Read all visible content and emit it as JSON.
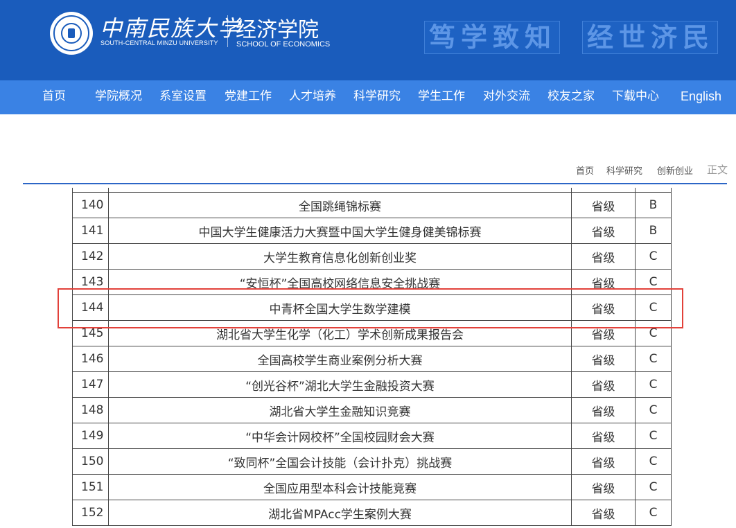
{
  "header": {
    "university_name_cn": "中南民族大学",
    "university_name_en": "SOUTH-CENTRAL MINZU UNIVERSITY",
    "school_name_cn": "经济学院",
    "school_name_en": "SCHOOL OF ECONOMICS",
    "motto_left": "笃学致知",
    "motto_right": "经世济民",
    "brand_color": "#1a5cbc"
  },
  "nav": {
    "items": [
      {
        "label": "首页"
      },
      {
        "label": "学院概况"
      },
      {
        "label": "系室设置"
      },
      {
        "label": "党建工作"
      },
      {
        "label": "人才培养"
      },
      {
        "label": "科学研究"
      },
      {
        "label": "学生工作"
      },
      {
        "label": "对外交流"
      },
      {
        "label": "校友之家"
      },
      {
        "label": "下载中心"
      },
      {
        "label": "English"
      }
    ],
    "color": "#3a82e4"
  },
  "breadcrumb": {
    "items": [
      "首页",
      "科学研究",
      "创新创业"
    ],
    "current": "正文"
  },
  "table": {
    "rows": [
      {
        "no": "140",
        "name": "全国跳绳锦标赛",
        "level": "省级",
        "grade": "B"
      },
      {
        "no": "141",
        "name": "中国大学生健康活力大赛暨中国大学生健身健美锦标赛",
        "level": "省级",
        "grade": "B"
      },
      {
        "no": "142",
        "name": "大学生教育信息化创新创业奖",
        "level": "省级",
        "grade": "C"
      },
      {
        "no": "143",
        "name": "“安恒杯”全国高校网络信息安全挑战赛",
        "level": "省级",
        "grade": "C"
      },
      {
        "no": "144",
        "name": "中青杯全国大学生数学建模",
        "level": "省级",
        "grade": "C"
      },
      {
        "no": "145",
        "name": "湖北省大学生化学（化工）学术创新成果报告会",
        "level": "省级",
        "grade": "C"
      },
      {
        "no": "146",
        "name": "全国高校学生商业案例分析大赛",
        "level": "省级",
        "grade": "C"
      },
      {
        "no": "147",
        "name": "“创光谷杯”湖北大学生金融投资大赛",
        "level": "省级",
        "grade": "C"
      },
      {
        "no": "148",
        "name": "湖北省大学生金融知识竞赛",
        "level": "省级",
        "grade": "C"
      },
      {
        "no": "149",
        "name": "“中华会计网校杯”全国校园财会大赛",
        "level": "省级",
        "grade": "C"
      },
      {
        "no": "150",
        "name": "“致同杯”全国会计技能（会计扑克）挑战赛",
        "level": "省级",
        "grade": "C"
      },
      {
        "no": "151",
        "name": "全国应用型本科会计技能竞赛",
        "level": "省级",
        "grade": "C"
      },
      {
        "no": "152",
        "name": "湖北省MPAcc学生案例大赛",
        "level": "省级",
        "grade": "C"
      }
    ],
    "highlight_color": "#e2413a"
  }
}
